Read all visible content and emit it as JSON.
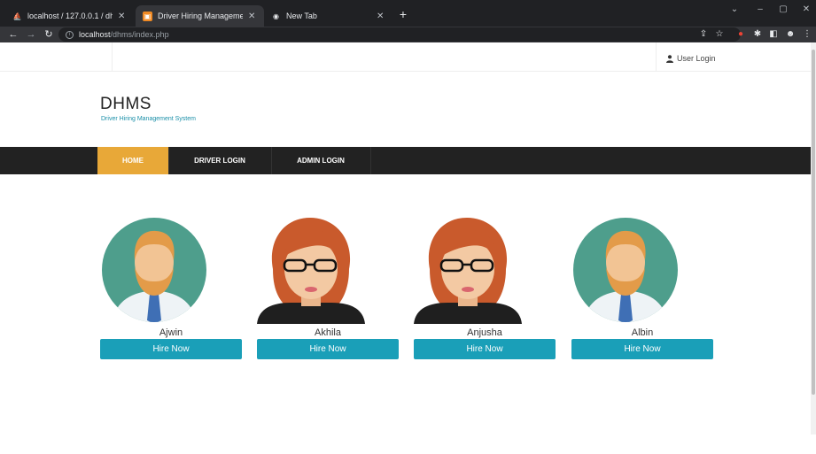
{
  "browser": {
    "tabs": [
      {
        "title": "localhost / 127.0.0.1 / dhmsdb / t",
        "active": false
      },
      {
        "title": "Driver Hiring Management Syste",
        "active": true
      },
      {
        "title": "New Tab",
        "active": false
      }
    ],
    "url": {
      "host": "localhost",
      "path": "/dhms/index.php"
    }
  },
  "page": {
    "topbar": {
      "user_login": "User Login"
    },
    "brand": {
      "title": "DHMS",
      "subtitle": "Driver Hiring Management System"
    },
    "nav": [
      {
        "label": "HOME",
        "active": true
      },
      {
        "label": "DRIVER LOGIN",
        "active": false
      },
      {
        "label": "ADMIN LOGIN",
        "active": false
      }
    ],
    "drivers": [
      {
        "name": "Ajwin",
        "avatar": "male-avatar",
        "button": "Hire Now"
      },
      {
        "name": "Akhila",
        "avatar": "female-avatar",
        "button": "Hire Now"
      },
      {
        "name": "Anjusha",
        "avatar": "female-avatar",
        "button": "Hire Now"
      },
      {
        "name": "Albin",
        "avatar": "male-avatar",
        "button": "Hire Now"
      }
    ]
  },
  "colors": {
    "accent": "#e8a838",
    "button": "#1a9fb8",
    "navbar": "#222222",
    "brand_sub": "#1a8fa8"
  }
}
